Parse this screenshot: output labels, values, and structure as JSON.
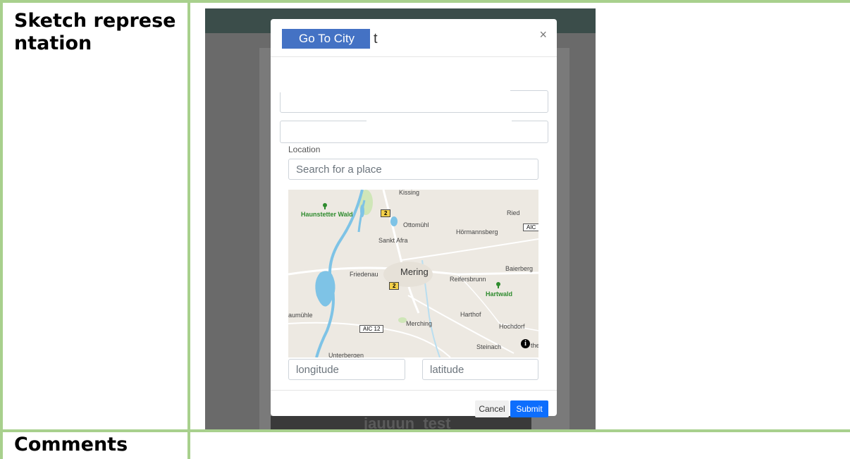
{
  "document": {
    "row1_label": "Sketch representation",
    "row2_label": "Comments"
  },
  "modal": {
    "title_partial": "t",
    "close_symbol": "×",
    "goto_city_label": "Go To City",
    "location_label": "Location",
    "search_placeholder": "Search for a place",
    "longitude_placeholder": "longitude",
    "latitude_placeholder": "latitude",
    "cancel_label": "Cancel",
    "submit_label": "Submit"
  },
  "background": {
    "bottom_text": "jauuun_test"
  },
  "map": {
    "labels": {
      "kissing": "Kissing",
      "haunstetter_wald": "Haunstetter Wald",
      "ottomuhl": "Ottomühl",
      "ried": "Ried",
      "hormannsberg": "Hörmannsberg",
      "sankt_afra": "Sankt Afra",
      "friedenau": "Friedenau",
      "mering": "Mering",
      "baierberg": "Baierberg",
      "reifersbrunn": "Reifersbrunn",
      "hartwald": "Hartwald",
      "aumuhle": "aumühle",
      "harthof": "Harthof",
      "merching": "Merching",
      "hochdorf": "Hochdorf",
      "steinach": "Steinach",
      "unterbergen": "Unterbergen",
      "attribution": "the"
    },
    "badges": {
      "road2a": "2",
      "road2b": "2",
      "aic_top": "AIC",
      "aic12": "AIC 12"
    },
    "info_symbol": "i"
  },
  "colors": {
    "table_border": "#a8d08d",
    "goto_city_bg": "#4472c4",
    "submit_bg": "#0d6efd",
    "water": "#7ec3e6",
    "map_land": "#ede9e2"
  }
}
